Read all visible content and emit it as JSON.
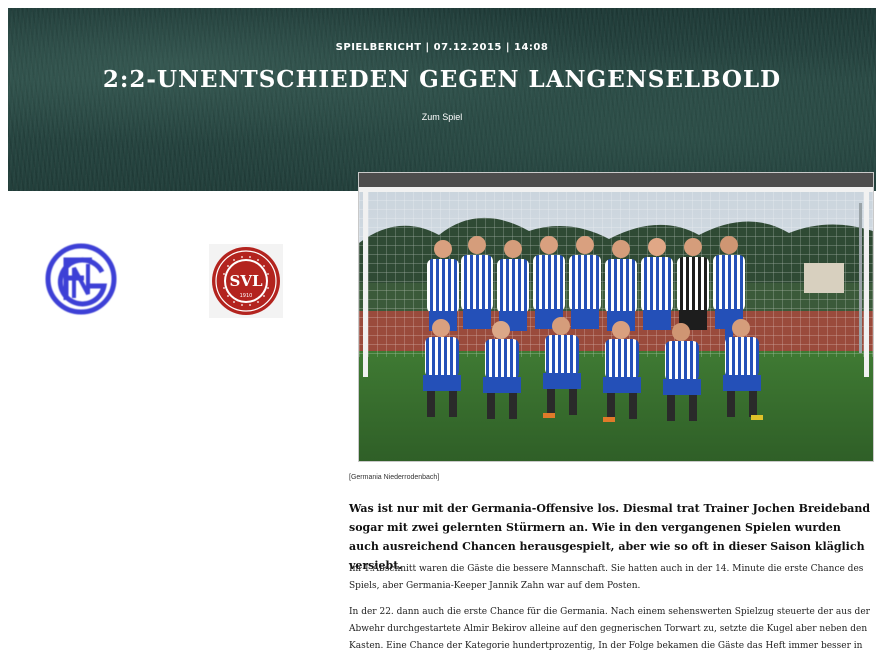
{
  "hero": {
    "meta": "SPIELBERICHT | 07.12.2015 | 14:08",
    "title": "2:2-UNENTSCHIEDEN GEGEN LANGENSELBOLD",
    "link": "Zum Spiel"
  },
  "teams": {
    "home_logo_icon": "germania-club-crest-icon",
    "away_logo_icon": "svl-club-crest-icon",
    "away_logo_text": "SVL",
    "away_logo_year": "1910"
  },
  "photo": {
    "caption": "[Germania Niederrodenbach]"
  },
  "article": {
    "lead": "Was ist nur mit der Germania-Offensive los. Diesmal trat Trainer Jochen Breideband sogar mit zwei gelernten Stürmern an. Wie in den vergangenen Spielen wurden auch ausreichend Chancen herausgespielt, aber wie so oft in dieser Saison kläglich versiebt.",
    "paragraphs": [
      "Im 1.Abschnitt waren die Gäste die bessere Mannschaft. Sie hatten auch in der 14. Minute die erste Chance des Spiels, aber Germania-Keeper Jannik Zahn war auf dem Posten.",
      "In der 22. dann auch die erste Chance für die Germania. Nach einem sehenswerten Spielzug steuerte der aus der Abwehr durchgestartete Almir Bekirov alleine auf den gegnerischen Torwart zu, setzte die Kugel aber neben den Kasten. Eine Chance der Kategorie hundertprozentig, In der Folge bekamen die Gäste das Heft immer besser in di"
    ]
  },
  "colors": {
    "hero_bg": "#223f3b",
    "home_crest": "#3d3fd6",
    "away_crest": "#b3241f",
    "jersey_blue": "#2450b8"
  }
}
